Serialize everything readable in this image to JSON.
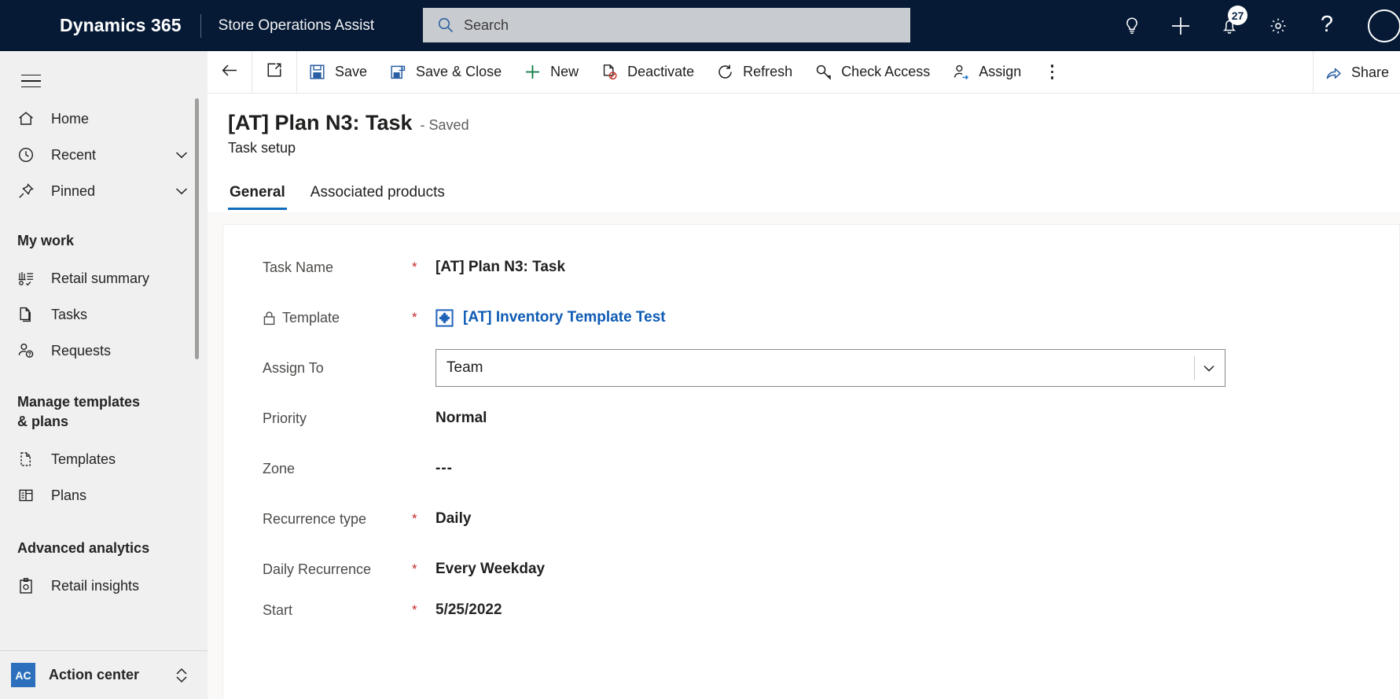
{
  "topbar": {
    "brand": "Dynamics 365",
    "app_name": "Store Operations Assist",
    "search_placeholder": "Search",
    "search_value": "",
    "icons": {
      "lightbulb": "lightbulb-icon",
      "plus": "plus-icon",
      "notifications": "bell-icon",
      "notifications_badge": "27",
      "settings": "gear-icon",
      "help": "?",
      "avatar": "avatar-icon"
    },
    "colors": {
      "background": "#061a36",
      "search_bg": "#c8ccd1"
    }
  },
  "sidebar": {
    "hamburger": "site-map-toggle",
    "items": [
      {
        "label": "Home",
        "icon": "home-icon",
        "expandable": false
      },
      {
        "label": "Recent",
        "icon": "clock-icon",
        "expandable": true
      },
      {
        "label": "Pinned",
        "icon": "pin-icon",
        "expandable": true
      }
    ],
    "groups": [
      {
        "title": "My work",
        "items": [
          {
            "label": "Retail summary",
            "icon": "chart-summary-icon"
          },
          {
            "label": "Tasks",
            "icon": "document-copy-icon"
          },
          {
            "label": "Requests",
            "icon": "person-question-icon"
          }
        ]
      },
      {
        "title": "Manage templates & plans",
        "items": [
          {
            "label": "Templates",
            "icon": "template-dashed-icon"
          },
          {
            "label": "Plans",
            "icon": "table-layout-icon"
          }
        ]
      },
      {
        "title": "Advanced analytics",
        "items": [
          {
            "label": "Retail insights",
            "icon": "clipboard-insights-icon"
          }
        ]
      }
    ],
    "action_center": {
      "initials": "AC",
      "label": "Action center",
      "badge_color": "#2c70bd"
    }
  },
  "commandbar": {
    "back": "back-arrow-icon",
    "popout": "open-in-new-window-icon",
    "buttons": [
      {
        "label": "Save",
        "icon": "save-icon"
      },
      {
        "label": "Save & Close",
        "icon": "save-and-close-icon"
      },
      {
        "label": "New",
        "icon": "plus-icon"
      },
      {
        "label": "Deactivate",
        "icon": "deactivate-icon"
      },
      {
        "label": "Refresh",
        "icon": "refresh-icon"
      },
      {
        "label": "Check Access",
        "icon": "key-icon"
      },
      {
        "label": "Assign",
        "icon": "person-assign-icon"
      }
    ],
    "overflow": "more-commands-icon",
    "share": {
      "label": "Share",
      "icon": "share-icon"
    }
  },
  "record": {
    "title": "[AT] Plan N3: Task",
    "status": "- Saved",
    "subtitle": "Task setup"
  },
  "tabs": [
    {
      "label": "General",
      "active": true
    },
    {
      "label": "Associated products",
      "active": false
    }
  ],
  "form": {
    "fields": [
      {
        "label": "Task Name",
        "required": "*",
        "value": "[AT] Plan N3: Task",
        "type": "text",
        "locked": false
      },
      {
        "label": "Template",
        "required": "*",
        "value": "[AT] Inventory Template Test",
        "type": "lookup-link",
        "locked": true,
        "icon": "template-entity-icon",
        "link_color": "#0f5bb5"
      },
      {
        "label": "Assign To",
        "required": "",
        "value": "Team",
        "type": "select",
        "locked": false,
        "chevron": "chevron-down-icon"
      },
      {
        "label": "Priority",
        "required": "",
        "value": "Normal",
        "type": "text",
        "locked": false
      },
      {
        "label": "Zone",
        "required": "",
        "value": "---",
        "type": "text",
        "locked": false
      },
      {
        "label": "Recurrence type",
        "required": "*",
        "value": "Daily",
        "type": "text",
        "locked": false
      },
      {
        "label": "Daily Recurrence",
        "required": "*",
        "value": "Every Weekday",
        "type": "text",
        "locked": false
      },
      {
        "label": "Start",
        "required": "*",
        "value": "5/25/2022",
        "type": "text",
        "locked": false
      }
    ]
  }
}
